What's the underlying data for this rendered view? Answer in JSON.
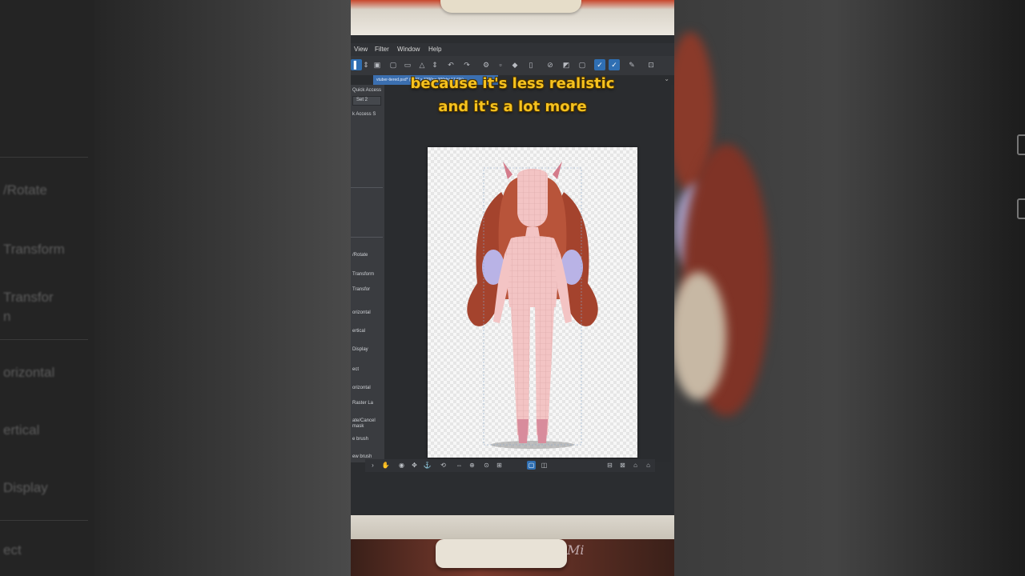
{
  "menu": {
    "view": "View",
    "filter": "Filter",
    "window": "Window",
    "help": "Help"
  },
  "document_tab": {
    "title": "vtuber-tiered.psd* (5027 x 7700px 300dpi 17.6%)"
  },
  "left_panel": {
    "header": "Quick Access",
    "set": "Set 2",
    "sub": "k Access S",
    "items": [
      "/Rotate",
      "Transform",
      "Transfor",
      "orizontal",
      "ertical",
      "Display",
      "ect",
      "orizontal",
      "Raster La",
      "ate/Cancel",
      "mask",
      "e brush",
      "ew brush"
    ]
  },
  "background_left_panel": {
    "labels": [
      "/Rotate",
      "Transform",
      "Transfor",
      "n",
      "orizontal",
      "ertical",
      "Display",
      "ect"
    ]
  },
  "captions": {
    "line1": "because it's less realistic",
    "line2": "and it's a lot more"
  },
  "watermark": "Mi"
}
